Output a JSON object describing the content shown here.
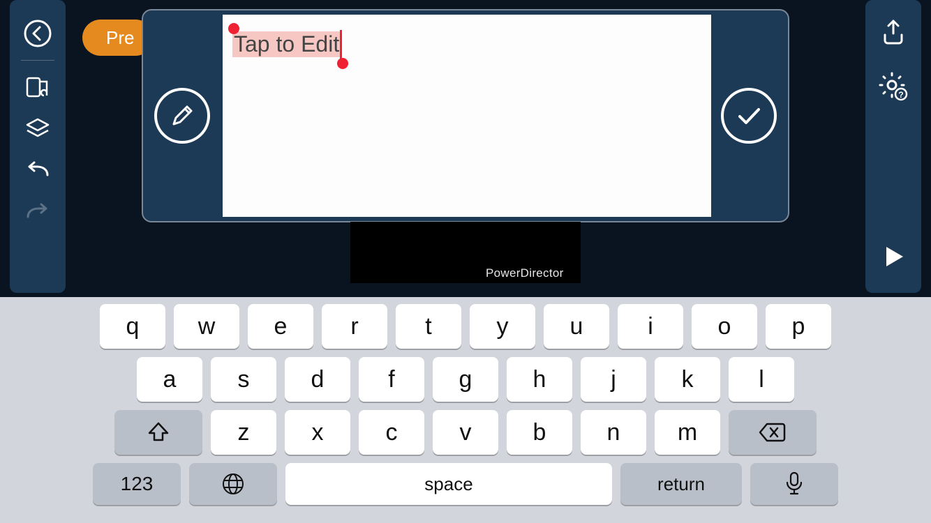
{
  "sidebar_left": {
    "items": [
      "back-icon",
      "media-library-icon",
      "layers-icon",
      "undo-icon",
      "redo-icon"
    ]
  },
  "sidebar_right": {
    "items_top": [
      "export-icon",
      "settings-help-icon"
    ],
    "play": "play-icon"
  },
  "premium": {
    "label": "Pre"
  },
  "text_panel": {
    "edit_button": "pencil-icon",
    "confirm_button": "check-icon",
    "selected_text": "Tap to Edit"
  },
  "watermark": "PowerDirector",
  "keyboard": {
    "row1": [
      "q",
      "w",
      "e",
      "r",
      "t",
      "y",
      "u",
      "i",
      "o",
      "p"
    ],
    "row2": [
      "a",
      "s",
      "d",
      "f",
      "g",
      "h",
      "j",
      "k",
      "l"
    ],
    "row3": [
      "z",
      "x",
      "c",
      "v",
      "b",
      "n",
      "m"
    ],
    "shift": "shift",
    "backspace": "backspace",
    "numkey": "123",
    "globe": "globe",
    "space": "space",
    "return": "return",
    "mic": "mic"
  }
}
